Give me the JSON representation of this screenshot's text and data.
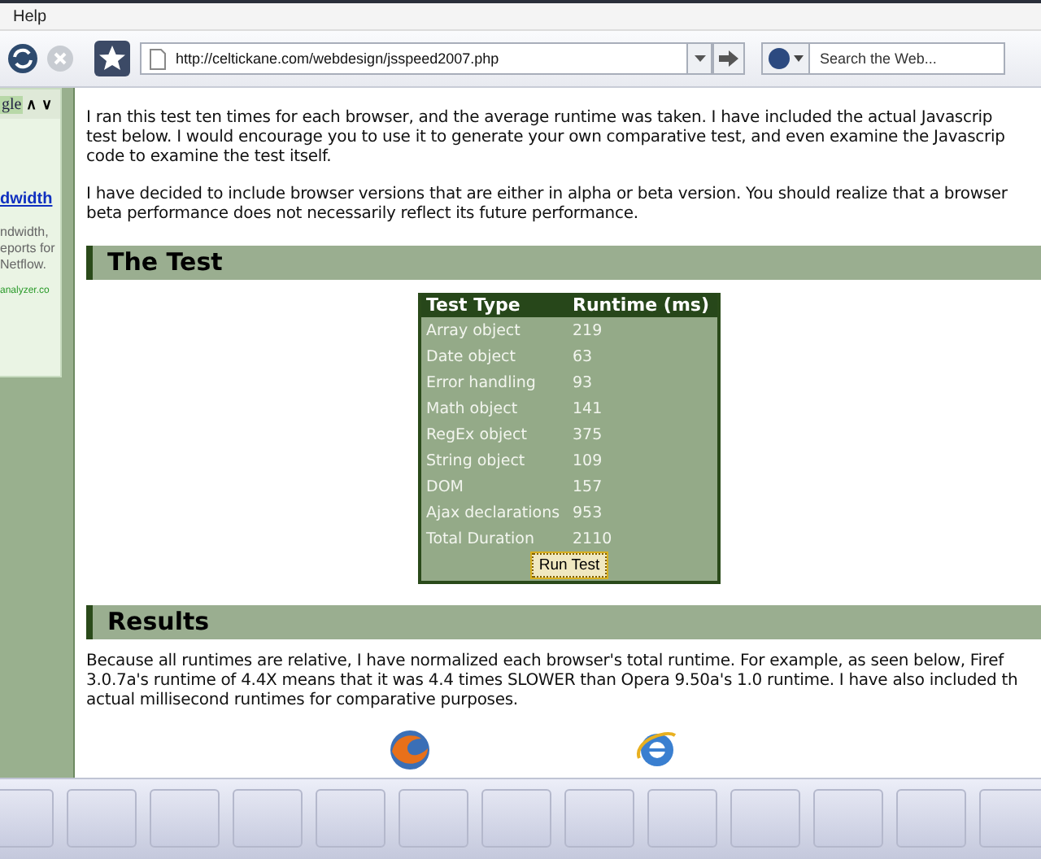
{
  "menu_bar": {
    "items": [
      {
        "label": "Help"
      }
    ]
  },
  "toolbar": {
    "address": "http://celtickane.com/webdesign/jsspeed2007.php",
    "search": {
      "placeholder": "Search the Web..."
    }
  },
  "sidebar_ad": {
    "logo": "gle",
    "arrows": "∧ ∨",
    "link": "dwidth",
    "lines": [
      "ndwidth,",
      "eports for",
      "Netflow."
    ],
    "url": "analyzer.co"
  },
  "article": {
    "paragraphs": [
      {
        "lines": [
          "I ran this test ten times for each browser, and the average runtime was taken. I have included the actual Javascrip",
          "test below. I would encourage you to use it to generate your own comparative test, and even examine the Javascrip",
          "code to examine the test itself."
        ]
      },
      {
        "lines": [
          "I have decided to include browser versions that are either in alpha or beta version. You should realize that a browser",
          "beta performance does not necessarily reflect its future performance."
        ]
      }
    ],
    "sections": [
      {
        "heading": "The Test",
        "table": {
          "columns": [
            "Test Type",
            "Runtime (ms)"
          ],
          "rows": [
            [
              "Array object",
              "219"
            ],
            [
              "Date object",
              "63"
            ],
            [
              "Error handling",
              "93"
            ],
            [
              "Math object",
              "141"
            ],
            [
              "RegEx object",
              "375"
            ],
            [
              "String object",
              "109"
            ],
            [
              "DOM",
              "157"
            ],
            [
              "Ajax declarations",
              "953"
            ],
            [
              "Total Duration",
              "2110"
            ]
          ],
          "button": "Run Test"
        }
      },
      {
        "heading": "Results",
        "paragraph": {
          "lines": [
            "Because all runtimes are relative, I have normalized each browser's total runtime. For example, as seen below, Firef",
            "3.0.7a's runtime of 4.4X means that it was 4.4 times SLOWER than Opera 9.50a's 1.0 runtime. I have also included th",
            "actual millisecond runtimes for comparative purposes."
          ]
        }
      }
    ]
  }
}
